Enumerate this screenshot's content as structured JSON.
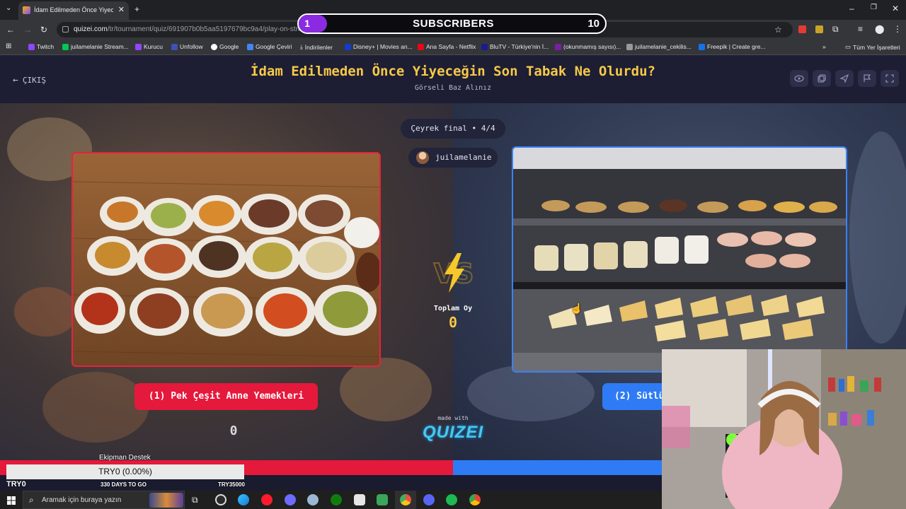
{
  "browser": {
    "tab_title": "İdam Edilmeden Önce Yiyeceğin Son Tabak Ne Olurdu?",
    "url_host": "quizei.com",
    "url_path": "/tr/tournament/quiz/691907b0b5aa5197679bc9a4/play-on-stream",
    "bookmarks": [
      "Twitch",
      "juilamelanie Stream...",
      "Kurucu",
      "Unfollow",
      "Google",
      "Google Çeviri",
      "İndirilenler",
      "Disney+ | Movies an...",
      "Ana Sayfa - Netflix",
      "BluTV - Türkiye'nin İ...",
      "(okunmamış sayısı)...",
      "juilamelanie_cekilis...",
      "Freepik | Create gre..."
    ],
    "all_bookmarks": "Tüm Yer İşaretleri"
  },
  "subscribers": {
    "current": "1",
    "label": "SUBSCRIBERS",
    "goal": "10"
  },
  "quiz": {
    "exit_label": "ÇIKIŞ",
    "title": "İdam Edilmeden Önce Yiyeceğin Son Tabak Ne Olurdu?",
    "subtitle": "Görseli Baz Alınız",
    "round": "Çeyrek final • 4/4",
    "streamer": "juilamelanie",
    "total_votes_label": "Toplam Oy",
    "total_votes": "0",
    "option_left": {
      "label": "(1) Pek Çeşit Anne Yemekleri",
      "votes": "0",
      "color": "#e5193b"
    },
    "option_right": {
      "label": "(2) Sütlü",
      "color": "#2f7bf5"
    },
    "made_with": "made with",
    "brand": "QUIZEI",
    "vote_split": {
      "left": 0.5,
      "right": 0.5
    }
  },
  "donation": {
    "title": "Ekipman Destek",
    "progress_text": "TRY0 (0.00%)",
    "progress": 0,
    "min": "TRY0",
    "days_left": "330 DAYS TO GO",
    "goal": "TRY35000"
  },
  "taskbar": {
    "search_placeholder": "Aramak için buraya yazın"
  }
}
